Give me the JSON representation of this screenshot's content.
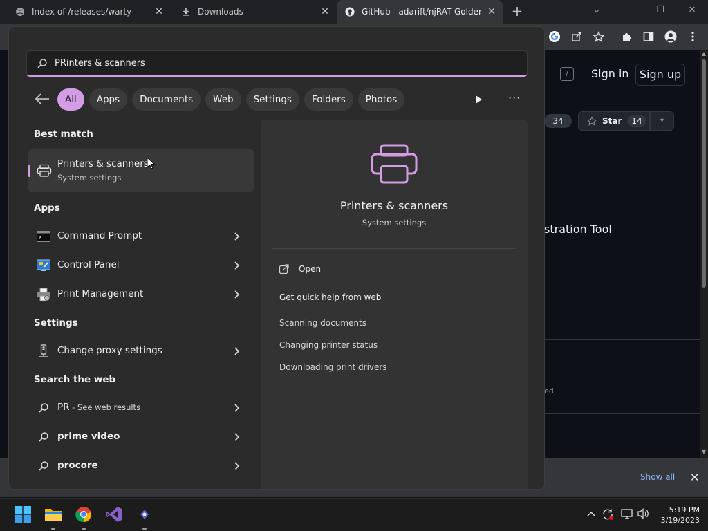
{
  "browser": {
    "tabs": [
      {
        "title": "Index of /releases/warty"
      },
      {
        "title": "Downloads"
      },
      {
        "title": "GitHub - adarift/njRAT-Golden-E"
      }
    ]
  },
  "github": {
    "slash_key": "/",
    "sign_in": "Sign in",
    "sign_up": "Sign up",
    "fork_count": "34",
    "star_label": "Star",
    "star_count": "14",
    "description_fragment": "stration Tool",
    "meta_fragment": "ed"
  },
  "downloads_bar": {
    "show_all": "Show all"
  },
  "search": {
    "query": "PRinters & scanners",
    "filters": [
      {
        "label": "All",
        "active": true
      },
      {
        "label": "Apps"
      },
      {
        "label": "Documents"
      },
      {
        "label": "Web"
      },
      {
        "label": "Settings"
      },
      {
        "label": "Folders"
      },
      {
        "label": "Photos"
      }
    ],
    "more": "···",
    "sections": {
      "best_match": "Best match",
      "apps": "Apps",
      "settings": "Settings",
      "web": "Search the web"
    },
    "best": {
      "title": "Printers & scanners",
      "subtitle": "System settings"
    },
    "apps": [
      {
        "label": "Command Prompt"
      },
      {
        "label": "Control Panel"
      },
      {
        "label": "Print Management"
      }
    ],
    "settings": [
      {
        "label": "Change proxy settings"
      }
    ],
    "web": [
      {
        "label": "PR",
        "suffix": " - See web results"
      },
      {
        "label": "prime video"
      },
      {
        "label": "procore"
      }
    ],
    "preview": {
      "title": "Printers & scanners",
      "subtitle": "System settings",
      "open": "Open",
      "quick_help": "Get quick help from web",
      "links": [
        "Scanning documents",
        "Changing printer status",
        "Downloading print drivers"
      ]
    }
  },
  "clock": {
    "time": "5:19 PM",
    "date": "3/19/2023"
  },
  "colors": {
    "accent": "#d59ce6"
  }
}
